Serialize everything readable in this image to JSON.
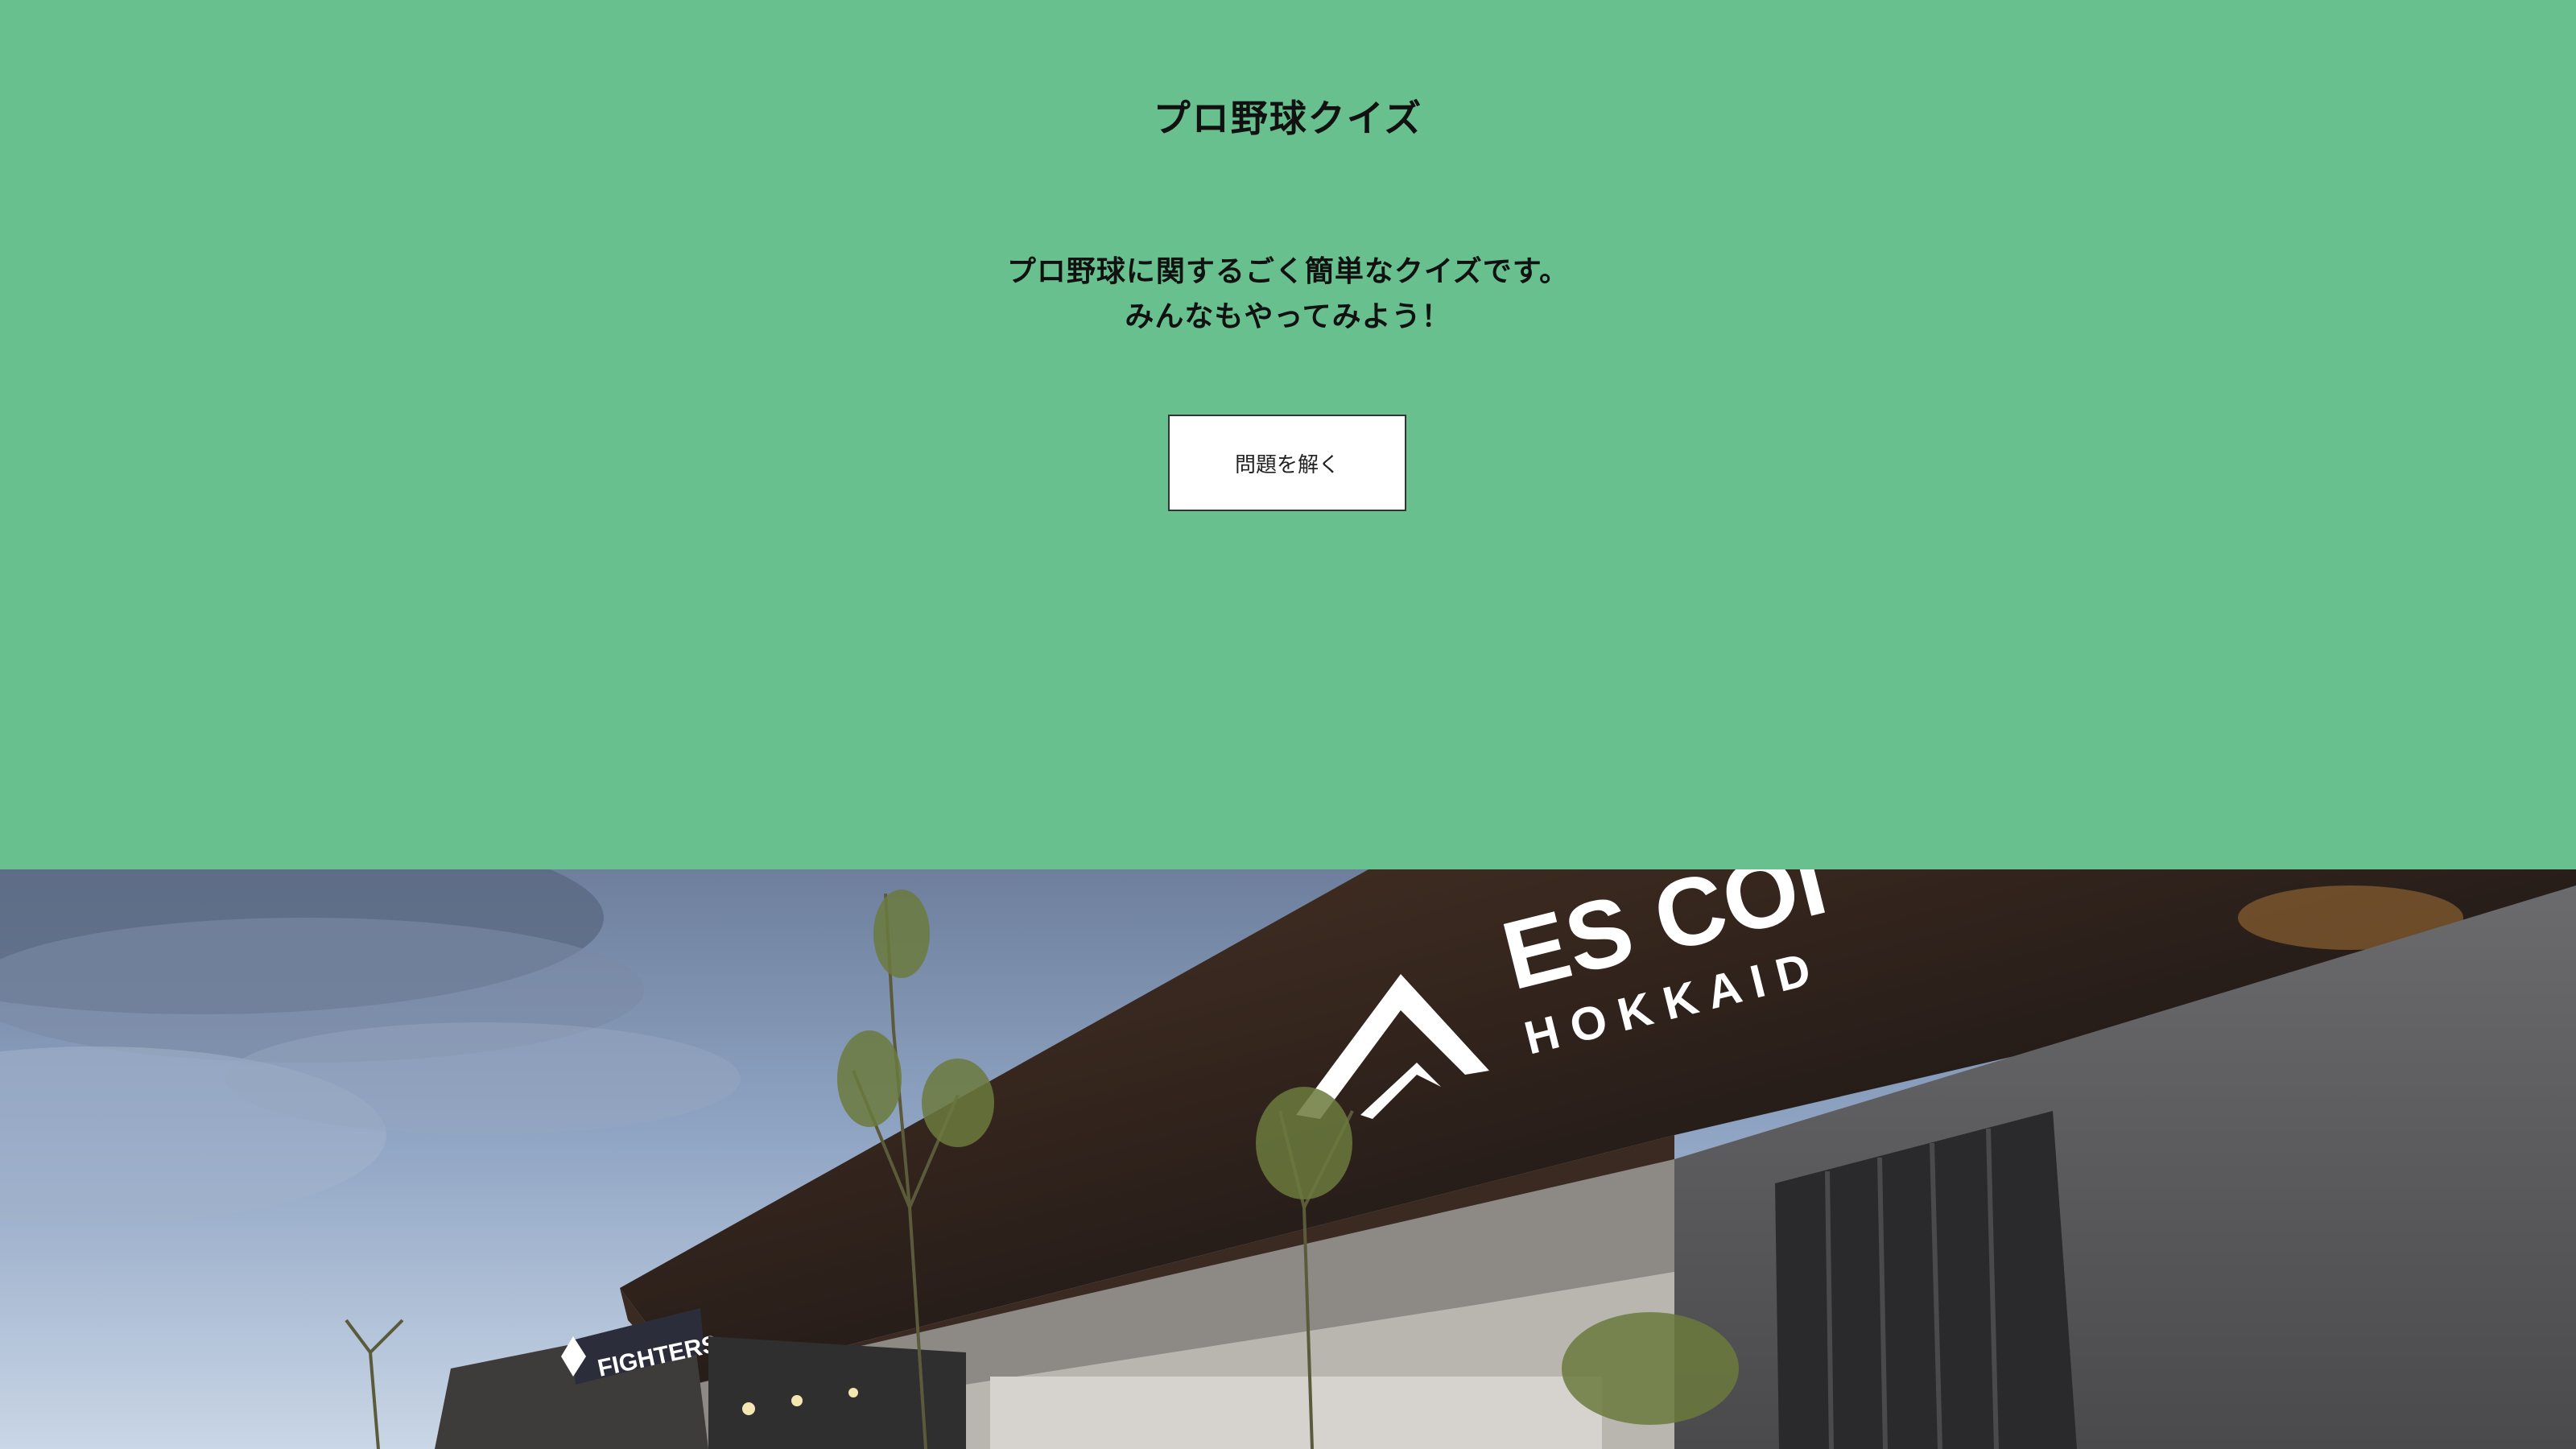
{
  "hero": {
    "title": "プロ野球クイズ",
    "description_line1": "プロ野球に関するごく簡単なクイズです。",
    "description_line2": "みんなもやってみよう！",
    "cta_label": "問題を解く"
  },
  "photo": {
    "sign_main": "ES COI",
    "sign_sub": "H O K K A I D",
    "small_sign": "FIGHTERS"
  },
  "colors": {
    "hero_bg": "#68c08f",
    "button_bg": "#ffffff",
    "text": "#111111"
  }
}
